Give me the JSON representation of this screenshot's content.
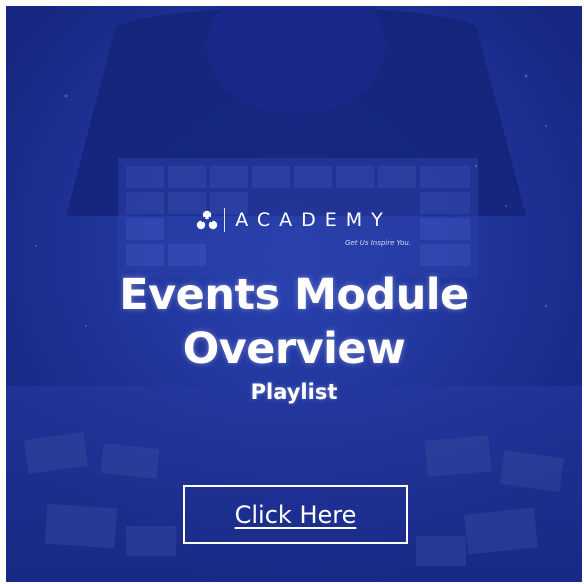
{
  "brand": {
    "name": "ACADEMY",
    "tagline": "Get Us Inspire You."
  },
  "title": {
    "line1": "Events Module",
    "line2": "Overview"
  },
  "subtitle": "Playlist",
  "cta": {
    "label": "Click Here"
  },
  "colors": {
    "overlay": "#1c2f8f",
    "text": "#ffffff"
  },
  "icons": {
    "logo": "academy-logo-icon"
  }
}
